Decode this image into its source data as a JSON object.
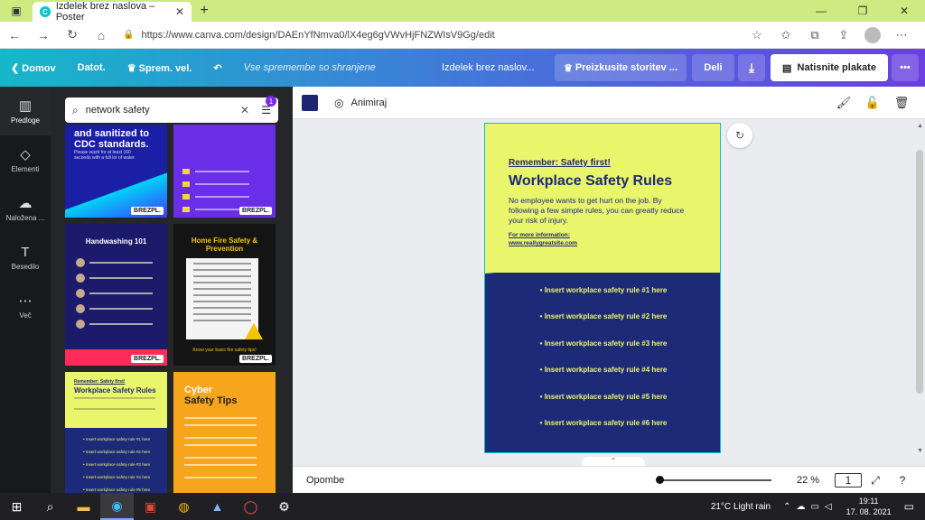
{
  "browser": {
    "tab_title": "Izdelek brez naslova – Poster",
    "favicon": "C",
    "url": "https://www.canva.com/design/DAEnYfNmva0/lX4eg6gVWvHjFNZWIsV9Gg/edit"
  },
  "header": {
    "home": "Domov",
    "file": "Datot.",
    "resize": "Sprem. vel.",
    "saved": "Vse spremembe so shranjene",
    "title": "Izdelek brez naslov...",
    "upgrade": "Preizkusite storitev ...",
    "share": "Deli",
    "print": "Natisnite plakate"
  },
  "rail": [
    {
      "icon": "templates-icon",
      "label": "Predloge"
    },
    {
      "icon": "elements-icon",
      "label": "Elementi"
    },
    {
      "icon": "uploads-icon",
      "label": "Naložena ..."
    },
    {
      "icon": "text-icon",
      "label": "Besedilo"
    },
    {
      "icon": "more-icon",
      "label": "Več"
    }
  ],
  "search": {
    "value": "network safety",
    "filter_count": "1"
  },
  "thumbs": {
    "t1_title": "and sanitized to CDC standards.",
    "t1_text": "Please wash for at least 160 seconds with a full lot of water.",
    "t3_title": "Handwashing 101",
    "t4_title": "Home Fire Safety & Prevention",
    "t4_footer": "Know your basic fire safety tips!",
    "t5_remember": "Remember: Safety first!",
    "t5_title": "Workplace Safety Rules",
    "t5_rules": [
      "• Insert workplace safety rule #1 here",
      "• Insert workplace safety rule #2 here",
      "• Insert workplace safety rule #3 here",
      "• Insert workplace safety rule #4 here",
      "• Insert workplace safety rule #5 here"
    ],
    "t6_title_a": "Cyber",
    "t6_title_b": "Safety Tips",
    "badge": "BREZPL."
  },
  "toolbar": {
    "color": "#1c2673",
    "animate": "Animiraj"
  },
  "poster": {
    "remember": "Remember: Safety first!",
    "title": "Workplace Safety Rules",
    "description": "No employee wants to get hurt on the job. By following a few simple rules, you can greatly reduce your risk of injury.",
    "more_label": "For more information:",
    "more_url": "www.reallygreatsite.com",
    "rules": [
      "• Insert workplace safety rule #1 here",
      "• Insert workplace safety rule #2 here",
      "• Insert workplace safety rule #3 here",
      "• Insert workplace safety rule #4 here",
      "• Insert workplace safety rule #5 here",
      "• Insert workplace safety rule #6 here"
    ],
    "colors": {
      "yellow": "#e9f56a",
      "navy": "#1d2a78"
    }
  },
  "bottom": {
    "notes": "Opombe",
    "zoom": "22 %",
    "zoom_level": 0.22,
    "page": "1"
  },
  "taskbar": {
    "weather": "21°C  Light rain",
    "time": "19:11",
    "date": "17. 08. 2021"
  }
}
